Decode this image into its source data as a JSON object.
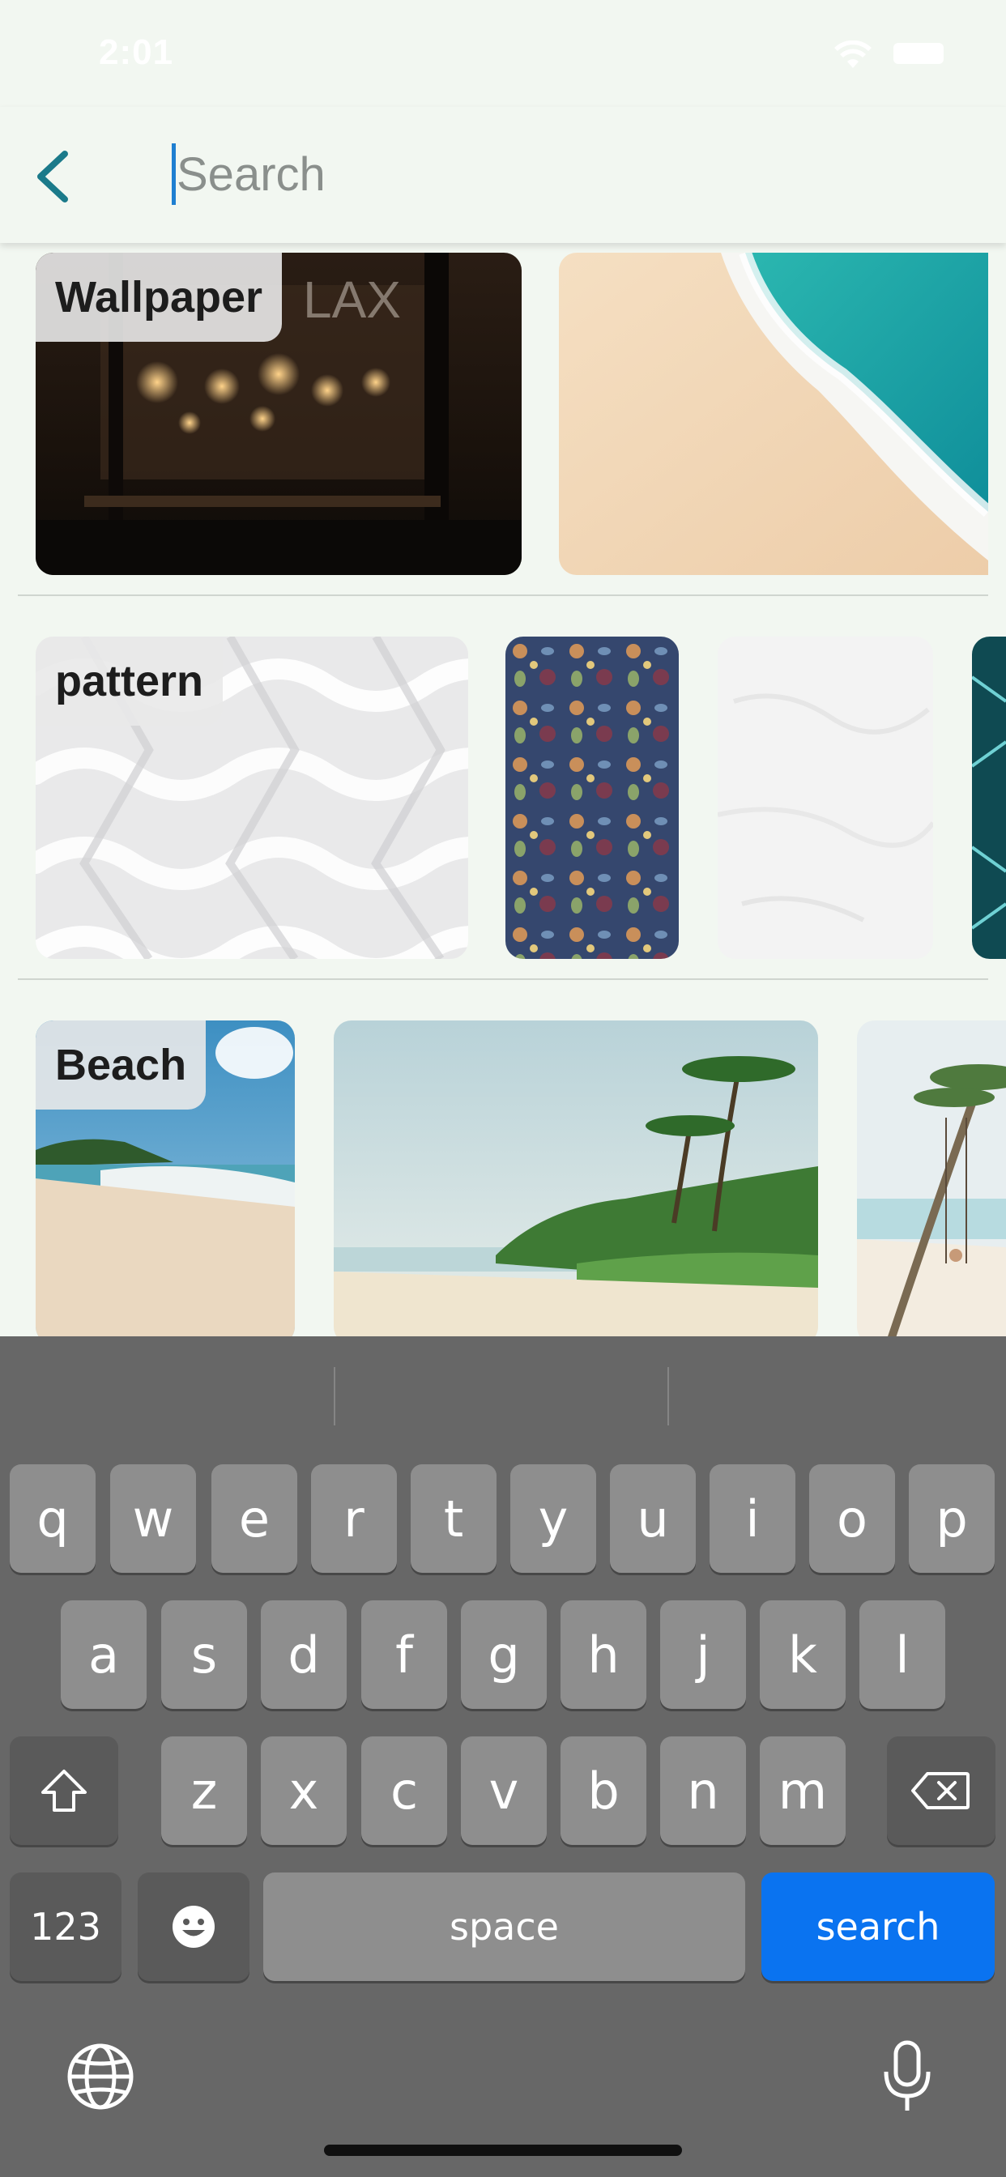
{
  "status_bar": {
    "time": "2:01"
  },
  "header": {
    "search_placeholder": "Search"
  },
  "categories": [
    {
      "label": "Wallpaper"
    },
    {
      "label": "pattern"
    },
    {
      "label": "Beach"
    }
  ],
  "keyboard": {
    "row1": [
      "q",
      "w",
      "e",
      "r",
      "t",
      "y",
      "u",
      "i",
      "o",
      "p"
    ],
    "row2": [
      "a",
      "s",
      "d",
      "f",
      "g",
      "h",
      "j",
      "k",
      "l"
    ],
    "row3": [
      "z",
      "x",
      "c",
      "v",
      "b",
      "n",
      "m"
    ],
    "numbers_label": "123",
    "space_label": "space",
    "search_label": "search"
  },
  "colors": {
    "accent": "#1b7a8a",
    "search_key": "#0a73f0",
    "background": "#f2f7f1",
    "keyboard_bg": "#676767"
  },
  "icons": {
    "back": "chevron-left-icon",
    "shift": "shift-icon",
    "delete": "backspace-icon",
    "emoji": "emoji-icon",
    "globe": "globe-icon",
    "mic": "microphone-icon"
  }
}
